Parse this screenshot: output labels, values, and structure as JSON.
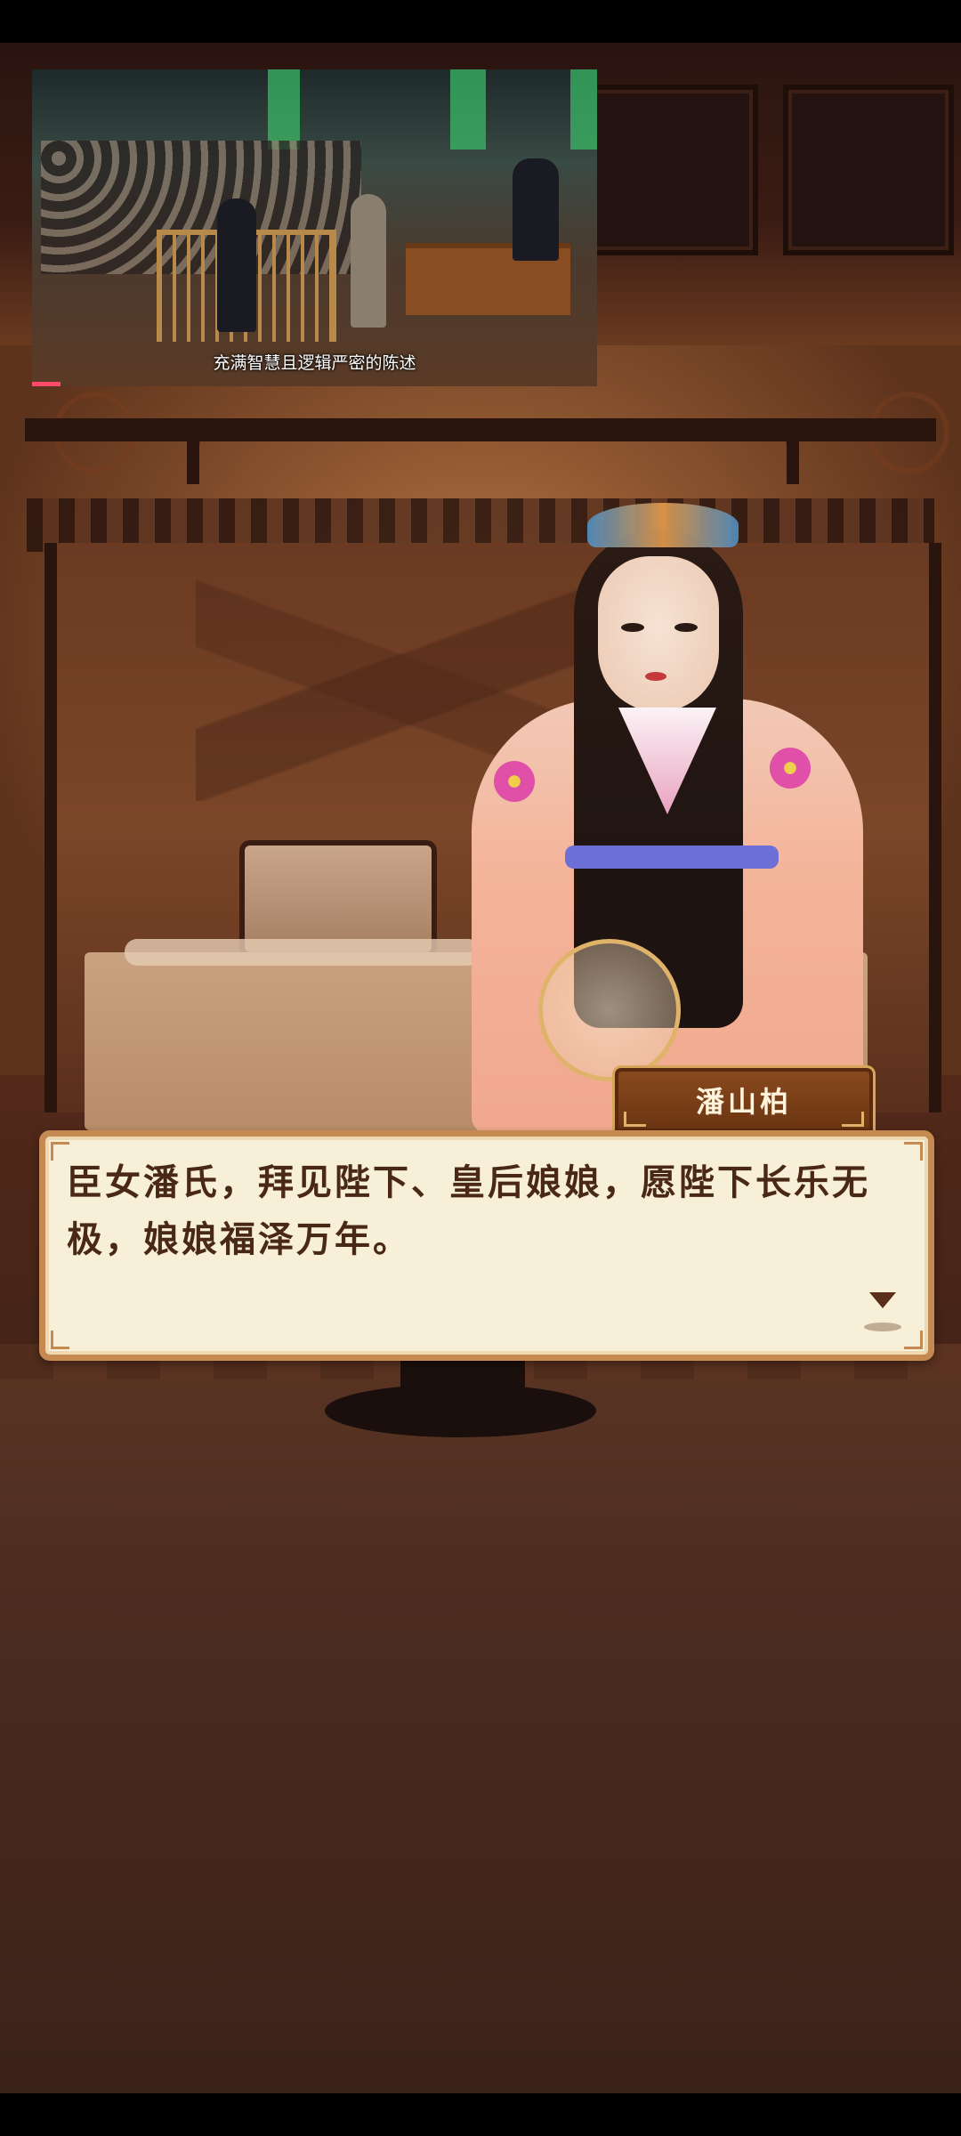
{
  "video": {
    "subtitle": "充满智慧且逻辑严密的陈述",
    "progress_fraction": 0.05
  },
  "scene": {
    "character_name": "潘山柏",
    "dialogue": "臣女潘氏，拜见陛下、皇后娘娘，愿陛下长乐无极，娘娘福泽万年。"
  },
  "icons": {
    "next": "triangle-down-icon"
  },
  "colors": {
    "dialog_bg": "#f7efd7",
    "dialog_border": "#c58a52",
    "dialog_text": "#4a2816",
    "nameplate_bg": "#8a4a1e",
    "progress": "#ff4b6a"
  }
}
